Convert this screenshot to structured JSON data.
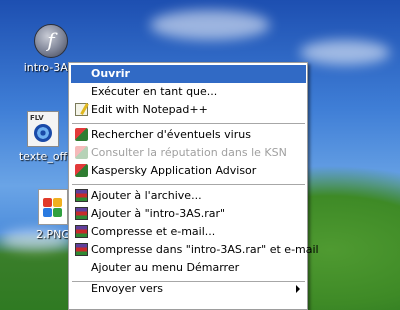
{
  "desktop": {
    "icons": [
      {
        "label": "intro-3AS.",
        "glyph": "f"
      },
      {
        "label": "texte_off",
        "glyph": "FLV"
      },
      {
        "label": "2.PNG",
        "glyph": ""
      }
    ]
  },
  "context_menu": {
    "items": [
      {
        "label": "Ouvrir",
        "icon": "",
        "state": "selected-default"
      },
      {
        "label": "Exécuter en tant que...",
        "icon": ""
      },
      {
        "label": "Edit with Notepad++",
        "icon": "notepad-plus-plus-icon"
      },
      {
        "label": "Rechercher d'éventuels virus",
        "icon": "kaspersky-icon"
      },
      {
        "label": "Consulter la réputation dans le KSN",
        "icon": "kaspersky-icon",
        "state": "disabled"
      },
      {
        "label": "Kaspersky Application Advisor",
        "icon": "kaspersky-icon"
      },
      {
        "label": "Ajouter à l'archive...",
        "icon": "winrar-icon"
      },
      {
        "label": "Ajouter à \"intro-3AS.rar\"",
        "icon": "winrar-icon"
      },
      {
        "label": "Compresse et e-mail...",
        "icon": "winrar-icon"
      },
      {
        "label": "Compresse dans \"intro-3AS.rar\" et e-mail",
        "icon": "winrar-icon"
      },
      {
        "label": "Ajouter au menu Démarrer",
        "icon": ""
      },
      {
        "label": "Envoyer vers",
        "icon": "",
        "submenu": true
      }
    ]
  },
  "colors": {
    "selection": "#316ac5",
    "menu_bg": "#ffffff",
    "disabled_text": "#a0a0a0"
  }
}
